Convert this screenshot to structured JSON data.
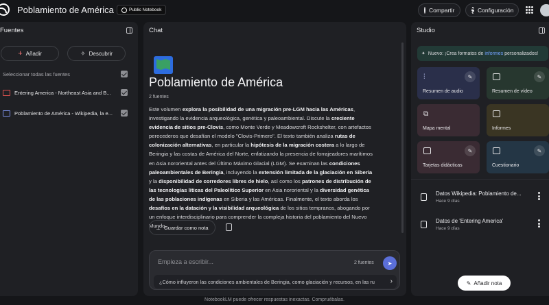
{
  "header": {
    "app_title": "Poblamiento de América",
    "badge": "Public Notebook",
    "share_label": "Compartir",
    "settings_label": "Configuración"
  },
  "sources": {
    "panel_title": "Fuentes",
    "add_label": "Añadir",
    "discover_label": "Descubrir",
    "select_all": "Seleccionar todas las fuentes",
    "items": [
      {
        "label": "Entering America - Northeast Asia and B...",
        "icon": "pdf-icon",
        "checked": true
      },
      {
        "label": "Poblamiento de América - Wikipedia, la e...",
        "icon": "web-page-icon",
        "checked": true
      }
    ]
  },
  "chat": {
    "panel_title": "Chat",
    "notebook_title": "Poblamiento de América",
    "source_count": "2 fuentes",
    "summary_parts": [
      {
        "t": "Este volumen "
      },
      {
        "t": "explora la posibilidad de una migración pre-LGM hacia las Américas",
        "b": true
      },
      {
        "t": ", investigando la evidencia arqueológica, genética y paleoambiental. Discute la "
      },
      {
        "t": "creciente evidencia de sitios pre-Clovis",
        "b": true
      },
      {
        "t": ", como Monte Verde y Meadowcroft Rockshelter, con artefactos perecederos que desafían el modelo \"Clovis-Primero\". El texto también analiza "
      },
      {
        "t": "rutas de colonización alternativas",
        "b": true
      },
      {
        "t": ", en particular la "
      },
      {
        "t": "hipótesis de la migración costera",
        "b": true
      },
      {
        "t": " a lo largo de Beringia y las costas de América del Norte, enfatizando la presencia de forrajeadores marítimos en Asia nororiental antes del Último Máximo Glacial (LGM). Se examinan las "
      },
      {
        "t": "condiciones paleoambientales de Beringia",
        "b": true
      },
      {
        "t": ", incluyendo la "
      },
      {
        "t": "extensión limitada de la glaciación en Siberia",
        "b": true
      },
      {
        "t": " y la "
      },
      {
        "t": "disponibilidad de corredores libres de hielo",
        "b": true
      },
      {
        "t": ", así como los "
      },
      {
        "t": "patrones de distribución de las tecnologías líticas del Paleolítico Superior",
        "b": true
      },
      {
        "t": " en Asia nororiental y la "
      },
      {
        "t": "diversidad genética de las poblaciones indígenas",
        "b": true
      },
      {
        "t": " en Siberia y las Américas. Finalmente, el texto aborda los "
      },
      {
        "t": "desafíos en la datación y la visibilidad arqueológica",
        "b": true
      },
      {
        "t": " de los sitios tempranos, abogando por un enfoque interdisciplinario para comprender la compleja historia del poblamiento del Nuevo Mundo."
      }
    ],
    "save_note_label": "Guardar como nota",
    "input_placeholder": "Empieza a escribir...",
    "input_source_count": "2 fuentes",
    "suggestion": "¿Cómo influyeron las condiciones ambientales de Beringia, como glaciación y recursos, en las ru"
  },
  "studio": {
    "panel_title": "Studio",
    "banner_prefix": "Nuevo: ¡Crea formatos de ",
    "banner_highlight": "informes",
    "banner_suffix": " personalizados!",
    "tiles": {
      "audio": "Resumen de audio",
      "video": "Resumen de vídeo",
      "mindmap": "Mapa mental",
      "reports": "Informes",
      "flashcards": "Tarjetas didácticas",
      "quiz": "Cuestionario"
    },
    "notes": [
      {
        "title": "Datos Wikipedia: Poblamiento de...",
        "time": "Hace 9 días"
      },
      {
        "title": "Datos de 'Entering America'",
        "time": "Hace 9 días"
      }
    ],
    "add_note_label": "Añadir nota"
  },
  "footer": "NotebookLM puede ofrecer respuestas inexactas. Compruébalas."
}
